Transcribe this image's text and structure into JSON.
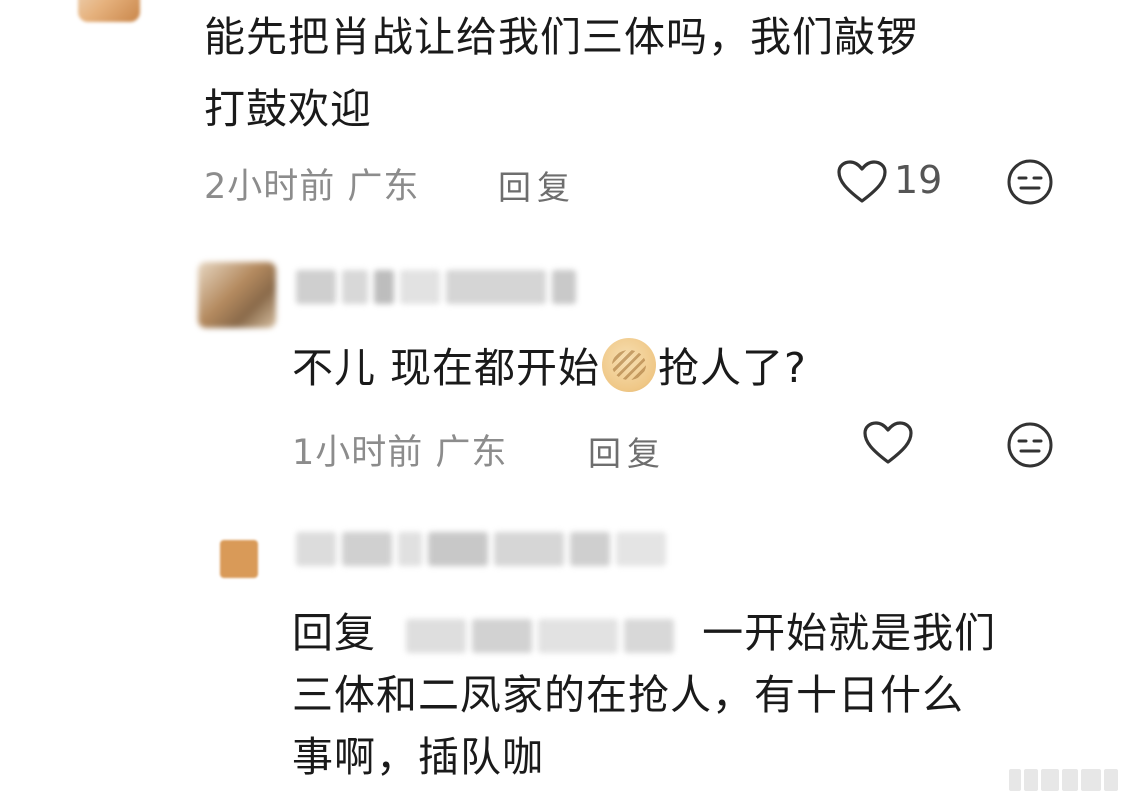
{
  "comment1": {
    "text_line1": "能先把肖战让给我们三体吗，我们敲锣",
    "text_line2": "打鼓欢迎",
    "time_location": "2小时前 广东",
    "reply_label": "回复",
    "like_count": "19"
  },
  "reply1": {
    "text_before_emoji": "不儿 现在都开始",
    "text_after_emoji": "抢人了?",
    "emoji": "pancake-emoji",
    "time_location": "1小时前 广东",
    "reply_label": "回复"
  },
  "reply2": {
    "reply_prefix": "回复",
    "text_line1": "一开始就是我们",
    "text_line2": "三体和二凤家的在抢人，有十日什么",
    "text_line3": "事啊，插队咖"
  },
  "icons": {
    "like": "heart-outline-icon",
    "more": "face-emoji-icon"
  },
  "colors": {
    "text": "#1a1a1a",
    "meta": "#8c8c8c",
    "background": "#ffffff"
  }
}
